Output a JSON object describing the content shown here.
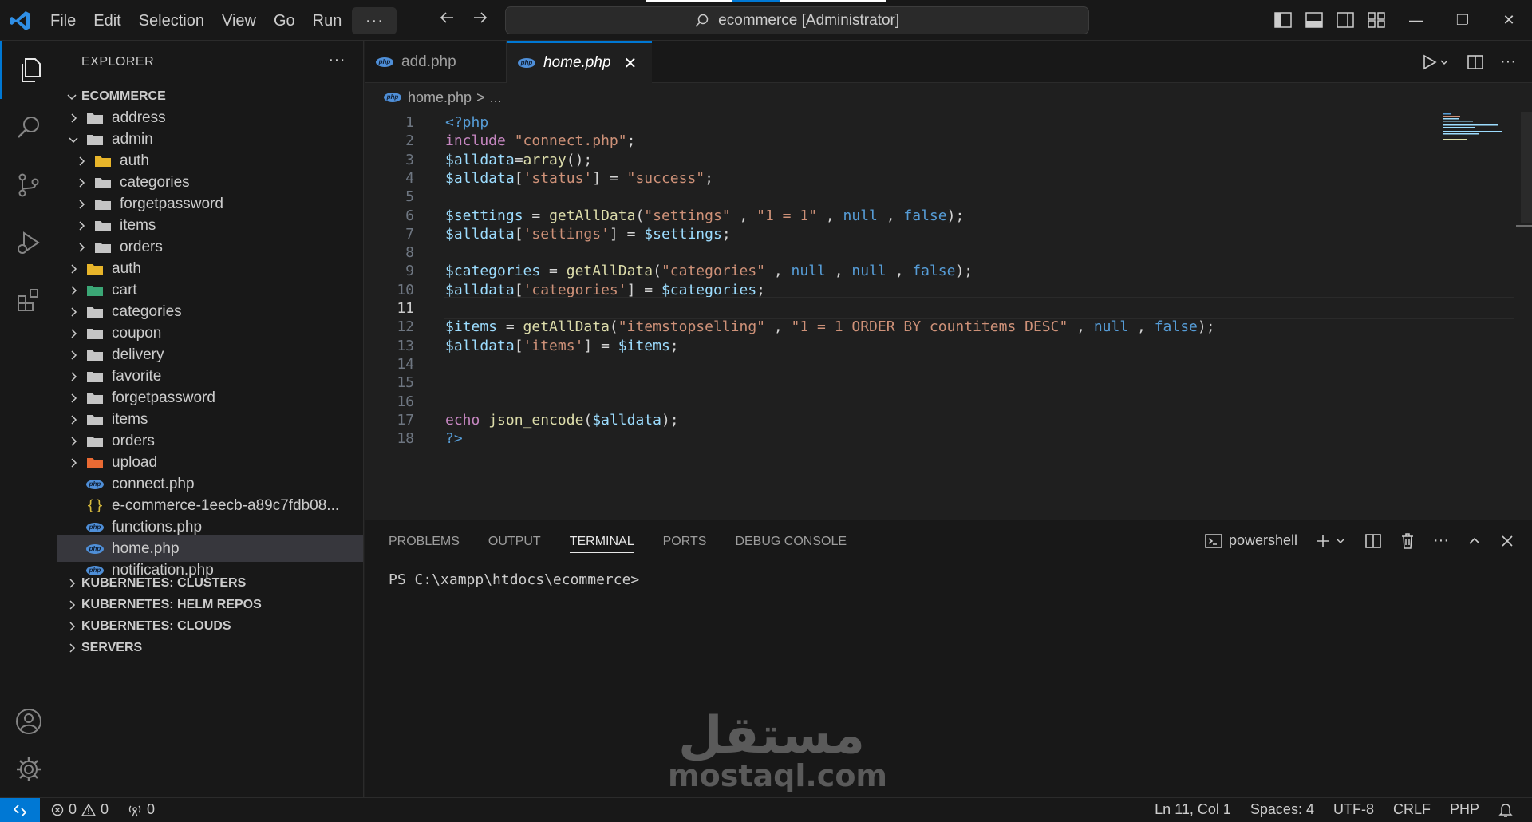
{
  "menu": [
    "File",
    "Edit",
    "Selection",
    "View",
    "Go",
    "Run"
  ],
  "menu_more": "···",
  "command_center": "ecommerce [Administrator]",
  "explorer": {
    "title": "EXPLORER",
    "more": "···",
    "root": "ECOMMERCE",
    "items": [
      {
        "label": "address",
        "kind": "folder"
      },
      {
        "label": "admin",
        "kind": "folder-open"
      },
      {
        "label": "auth",
        "kind": "folder-special"
      },
      {
        "label": "categories",
        "kind": "folder"
      },
      {
        "label": "forgetpassword",
        "kind": "folder"
      },
      {
        "label": "items",
        "kind": "folder"
      },
      {
        "label": "orders",
        "kind": "folder"
      },
      {
        "label": "auth",
        "kind": "folder-special"
      },
      {
        "label": "cart",
        "kind": "folder-cart"
      },
      {
        "label": "categories",
        "kind": "folder"
      },
      {
        "label": "coupon",
        "kind": "folder"
      },
      {
        "label": "delivery",
        "kind": "folder"
      },
      {
        "label": "favorite",
        "kind": "folder"
      },
      {
        "label": "forgetpassword",
        "kind": "folder"
      },
      {
        "label": "items",
        "kind": "folder"
      },
      {
        "label": "orders",
        "kind": "folder"
      },
      {
        "label": "upload",
        "kind": "folder-upload"
      },
      {
        "label": "connect.php",
        "kind": "php"
      },
      {
        "label": "e-commerce-1eecb-a89c7fdb08...",
        "kind": "json"
      },
      {
        "label": "functions.php",
        "kind": "php"
      },
      {
        "label": "home.php",
        "kind": "php"
      },
      {
        "label": "notification.php",
        "kind": "php"
      }
    ],
    "sections": [
      "KUBERNETES: CLUSTERS",
      "KUBERNETES: HELM REPOS",
      "KUBERNETES: CLOUDS",
      "SERVERS"
    ]
  },
  "tabs": [
    {
      "label": "add.php"
    },
    {
      "label": "home.php",
      "close": "✕"
    }
  ],
  "breadcrumb": {
    "file": "home.php",
    "sep": ">",
    "rest": "..."
  },
  "code_lines": [
    {
      "n": "1",
      "tokens": [
        [
          "k-php",
          "<?php"
        ]
      ]
    },
    {
      "n": "2",
      "tokens": [
        [
          "k-ctrl",
          "include"
        ],
        [
          "k-plain",
          " "
        ],
        [
          "k-str",
          "\"connect.php\""
        ],
        [
          "k-plain",
          ";"
        ]
      ]
    },
    {
      "n": "3",
      "tokens": [
        [
          "k-var",
          "$alldata"
        ],
        [
          "k-plain",
          "="
        ],
        [
          "k-fn",
          "array"
        ],
        [
          "k-plain",
          "();"
        ]
      ]
    },
    {
      "n": "4",
      "tokens": [
        [
          "k-var",
          "$alldata"
        ],
        [
          "k-plain",
          "["
        ],
        [
          "k-str",
          "'status'"
        ],
        [
          "k-plain",
          "] = "
        ],
        [
          "k-str",
          "\"success\""
        ],
        [
          "k-plain",
          ";"
        ]
      ]
    },
    {
      "n": "5",
      "tokens": []
    },
    {
      "n": "6",
      "tokens": [
        [
          "k-var",
          "$settings"
        ],
        [
          "k-plain",
          " = "
        ],
        [
          "k-fn",
          "getAllData"
        ],
        [
          "k-plain",
          "("
        ],
        [
          "k-str",
          "\"settings\""
        ],
        [
          "k-plain",
          " , "
        ],
        [
          "k-str",
          "\"1 = 1\""
        ],
        [
          "k-plain",
          " , "
        ],
        [
          "k-kw",
          "null"
        ],
        [
          "k-plain",
          " , "
        ],
        [
          "k-kw",
          "false"
        ],
        [
          "k-plain",
          ");"
        ]
      ]
    },
    {
      "n": "7",
      "tokens": [
        [
          "k-var",
          "$alldata"
        ],
        [
          "k-plain",
          "["
        ],
        [
          "k-str",
          "'settings'"
        ],
        [
          "k-plain",
          "] = "
        ],
        [
          "k-var",
          "$settings"
        ],
        [
          "k-plain",
          ";"
        ]
      ]
    },
    {
      "n": "8",
      "tokens": []
    },
    {
      "n": "9",
      "tokens": [
        [
          "k-var",
          "$categories"
        ],
        [
          "k-plain",
          " = "
        ],
        [
          "k-fn",
          "getAllData"
        ],
        [
          "k-plain",
          "("
        ],
        [
          "k-str",
          "\"categories\""
        ],
        [
          "k-plain",
          " , "
        ],
        [
          "k-kw",
          "null"
        ],
        [
          "k-plain",
          " , "
        ],
        [
          "k-kw",
          "null"
        ],
        [
          "k-plain",
          " , "
        ],
        [
          "k-kw",
          "false"
        ],
        [
          "k-plain",
          ");"
        ]
      ]
    },
    {
      "n": "10",
      "tokens": [
        [
          "k-var",
          "$alldata"
        ],
        [
          "k-plain",
          "["
        ],
        [
          "k-str",
          "'categories'"
        ],
        [
          "k-plain",
          "] = "
        ],
        [
          "k-var",
          "$categories"
        ],
        [
          "k-plain",
          ";"
        ]
      ]
    },
    {
      "n": "11",
      "tokens": []
    },
    {
      "n": "12",
      "tokens": [
        [
          "k-var",
          "$items"
        ],
        [
          "k-plain",
          " = "
        ],
        [
          "k-fn",
          "getAllData"
        ],
        [
          "k-plain",
          "("
        ],
        [
          "k-str",
          "\"itemstopselling\""
        ],
        [
          "k-plain",
          " , "
        ],
        [
          "k-str",
          "\"1 = 1 ORDER BY countitems DESC\""
        ],
        [
          "k-plain",
          " , "
        ],
        [
          "k-kw",
          "null"
        ],
        [
          "k-plain",
          " , "
        ],
        [
          "k-kw",
          "false"
        ],
        [
          "k-plain",
          ");"
        ]
      ]
    },
    {
      "n": "13",
      "tokens": [
        [
          "k-var",
          "$alldata"
        ],
        [
          "k-plain",
          "["
        ],
        [
          "k-str",
          "'items'"
        ],
        [
          "k-plain",
          "] = "
        ],
        [
          "k-var",
          "$items"
        ],
        [
          "k-plain",
          ";"
        ]
      ]
    },
    {
      "n": "14",
      "tokens": []
    },
    {
      "n": "15",
      "tokens": []
    },
    {
      "n": "16",
      "tokens": []
    },
    {
      "n": "17",
      "tokens": [
        [
          "k-ctrl",
          "echo"
        ],
        [
          "k-plain",
          " "
        ],
        [
          "k-fn",
          "json_encode"
        ],
        [
          "k-plain",
          "("
        ],
        [
          "k-var",
          "$alldata"
        ],
        [
          "k-plain",
          ");"
        ]
      ]
    },
    {
      "n": "18",
      "tokens": [
        [
          "k-php",
          "?>"
        ]
      ]
    }
  ],
  "current_line": "11",
  "panel": {
    "tabs": [
      "PROBLEMS",
      "OUTPUT",
      "TERMINAL",
      "PORTS",
      "DEBUG CONSOLE"
    ],
    "active_tab": "TERMINAL",
    "shell": "powershell",
    "prompt": "PS C:\\xampp\\htdocs\\ecommerce>"
  },
  "watermark": {
    "arabic": "مستقل",
    "latin": "mostaql.com"
  },
  "status": {
    "errors": "0",
    "warnings": "0",
    "ports": "0",
    "position": "Ln 11, Col 1",
    "spaces": "Spaces: 4",
    "encoding": "UTF-8",
    "eol": "CRLF",
    "language": "PHP"
  },
  "colors": {
    "accent": "#0078d4",
    "background": "#1f1f1f",
    "sidebar": "#181818"
  }
}
